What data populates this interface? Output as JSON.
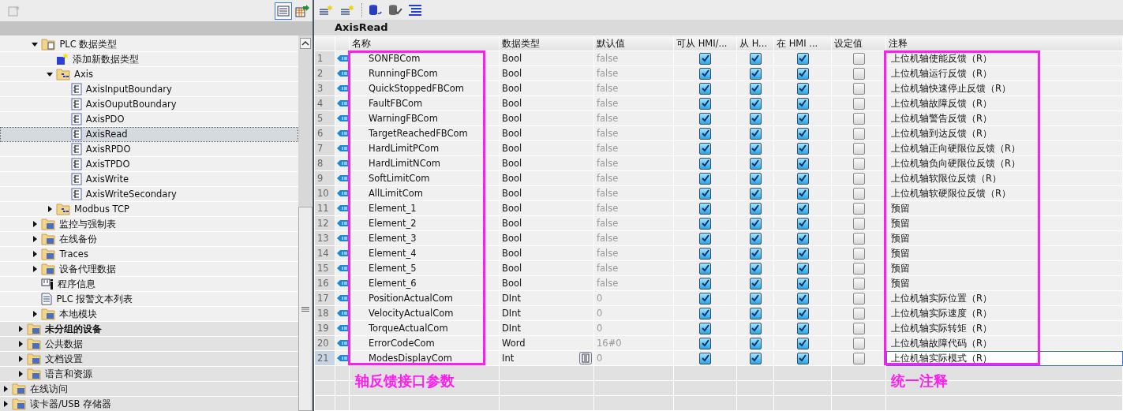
{
  "left_toolbar": {
    "view_toggle": {
      "selected": true
    }
  },
  "tree": {
    "items": [
      {
        "children": [
          {
            "children": [
              {
                "label": "PLC 数据类型",
                "kind": "typefolder",
                "expanded": true,
                "selected": false,
                "children": [
                  {
                    "label": "添加新数据类型",
                    "kind": "add",
                    "selected": false
                  },
                  {
                    "label": "Axis",
                    "kind": "structfolder",
                    "expanded": true,
                    "selected": false,
                    "children": [
                      {
                        "label": "AxisInputBoundary",
                        "kind": "type",
                        "selected": false
                      },
                      {
                        "label": "AxisOuputBoundary",
                        "kind": "type",
                        "selected": false
                      },
                      {
                        "label": "AxisPDO",
                        "kind": "type",
                        "selected": false
                      },
                      {
                        "label": "AxisRead",
                        "kind": "type",
                        "selected": true
                      },
                      {
                        "label": "AxisRPDO",
                        "kind": "type",
                        "selected": false
                      },
                      {
                        "label": "AxisTPDO",
                        "kind": "type",
                        "selected": false
                      },
                      {
                        "label": "AxisWrite",
                        "kind": "type",
                        "selected": false
                      },
                      {
                        "label": "AxisWriteSecondary",
                        "kind": "type",
                        "selected": false
                      }
                    ]
                  },
                  {
                    "label": "Modbus TCP",
                    "kind": "structfolder",
                    "expanded": false,
                    "selected": false
                  }
                ]
              },
              {
                "label": "监控与强制表",
                "kind": "folder",
                "expanded": false,
                "selected": false
              },
              {
                "label": "在线备份",
                "kind": "folder",
                "expanded": false,
                "selected": false
              },
              {
                "label": "Traces",
                "kind": "folder",
                "expanded": false,
                "selected": false
              },
              {
                "label": "设备代理数据",
                "kind": "folder",
                "expanded": false,
                "selected": false
              },
              {
                "label": "程序信息",
                "kind": "info",
                "selected": false
              },
              {
                "label": "PLC 报警文本列表",
                "kind": "textlist",
                "selected": false
              },
              {
                "label": "本地模块",
                "kind": "folder",
                "expanded": false,
                "selected": false
              }
            ]
          },
          {
            "label": "未分组的设备",
            "kind": "folder",
            "expanded": false,
            "selected": false,
            "bold": true
          },
          {
            "label": "公共数据",
            "kind": "folder",
            "expanded": false,
            "selected": false
          },
          {
            "label": "文档设置",
            "kind": "folder",
            "expanded": false,
            "selected": false
          },
          {
            "label": "语言和资源",
            "kind": "folder",
            "expanded": false,
            "selected": false
          }
        ]
      },
      {
        "label": "在线访问",
        "kind": "folder",
        "expanded": false,
        "selected": false
      },
      {
        "label": "读卡器/USB 存储器",
        "kind": "folder",
        "expanded": false,
        "selected": false
      }
    ]
  },
  "editor": {
    "title": "AxisRead",
    "columns": [
      "名称",
      "数据类型",
      "默认值",
      "可从 HMI/...",
      "从 H...",
      "在 HMI ...",
      "设定值",
      "注释"
    ],
    "rows": [
      {
        "number": "1",
        "name": "SONFBCom",
        "data_type": "Bool",
        "default_value": "false",
        "check_1": true,
        "check_2": true,
        "check_3": true,
        "setpoint": false,
        "comment": "上位机轴使能反馈（R）",
        "selected": false
      },
      {
        "number": "2",
        "name": "RunningFBCom",
        "data_type": "Bool",
        "default_value": "false",
        "check_1": true,
        "check_2": true,
        "check_3": true,
        "setpoint": false,
        "comment": "上位机轴运行反馈（R）",
        "selected": false
      },
      {
        "number": "3",
        "name": "QuickStoppedFBCom",
        "data_type": "Bool",
        "default_value": "false",
        "check_1": true,
        "check_2": true,
        "check_3": true,
        "setpoint": false,
        "comment": "上位机轴快速停止反馈（R）",
        "selected": false
      },
      {
        "number": "4",
        "name": "FaultFBCom",
        "data_type": "Bool",
        "default_value": "false",
        "check_1": true,
        "check_2": true,
        "check_3": true,
        "setpoint": false,
        "comment": "上位机轴故障反馈（R）",
        "selected": false
      },
      {
        "number": "5",
        "name": "WarningFBCom",
        "data_type": "Bool",
        "default_value": "false",
        "check_1": true,
        "check_2": true,
        "check_3": true,
        "setpoint": false,
        "comment": "上位机轴警告反馈（R）",
        "selected": false
      },
      {
        "number": "6",
        "name": "TargetReachedFBCom",
        "data_type": "Bool",
        "default_value": "false",
        "check_1": true,
        "check_2": true,
        "check_3": true,
        "setpoint": false,
        "comment": "上位机轴到达反馈（R）",
        "selected": false
      },
      {
        "number": "7",
        "name": "HardLimitPCom",
        "data_type": "Bool",
        "default_value": "false",
        "check_1": true,
        "check_2": true,
        "check_3": true,
        "setpoint": false,
        "comment": "上位机轴正向硬限位反馈（R）",
        "selected": false
      },
      {
        "number": "8",
        "name": "HardLimitNCom",
        "data_type": "Bool",
        "default_value": "false",
        "check_1": true,
        "check_2": true,
        "check_3": true,
        "setpoint": false,
        "comment": "上位机轴负向硬限位反馈（R）",
        "selected": false
      },
      {
        "number": "9",
        "name": "SoftLimitCom",
        "data_type": "Bool",
        "default_value": "false",
        "check_1": true,
        "check_2": true,
        "check_3": true,
        "setpoint": false,
        "comment": "上位机轴软限位反馈（R）",
        "selected": false
      },
      {
        "number": "10",
        "name": "AllLimitCom",
        "data_type": "Bool",
        "default_value": "false",
        "check_1": true,
        "check_2": true,
        "check_3": true,
        "setpoint": false,
        "comment": "上位机轴软硬限位反馈（R）",
        "selected": false
      },
      {
        "number": "11",
        "name": "Element_1",
        "data_type": "Bool",
        "default_value": "false",
        "check_1": true,
        "check_2": true,
        "check_3": true,
        "setpoint": false,
        "comment": "预留",
        "selected": false
      },
      {
        "number": "12",
        "name": "Element_2",
        "data_type": "Bool",
        "default_value": "false",
        "check_1": true,
        "check_2": true,
        "check_3": true,
        "setpoint": false,
        "comment": "预留",
        "selected": false
      },
      {
        "number": "13",
        "name": "Element_3",
        "data_type": "Bool",
        "default_value": "false",
        "check_1": true,
        "check_2": true,
        "check_3": true,
        "setpoint": false,
        "comment": "预留",
        "selected": false
      },
      {
        "number": "14",
        "name": "Element_4",
        "data_type": "Bool",
        "default_value": "false",
        "check_1": true,
        "check_2": true,
        "check_3": true,
        "setpoint": false,
        "comment": "预留",
        "selected": false
      },
      {
        "number": "15",
        "name": "Element_5",
        "data_type": "Bool",
        "default_value": "false",
        "check_1": true,
        "check_2": true,
        "check_3": true,
        "setpoint": false,
        "comment": "预留",
        "selected": false
      },
      {
        "number": "16",
        "name": "Element_6",
        "data_type": "Bool",
        "default_value": "false",
        "check_1": true,
        "check_2": true,
        "check_3": true,
        "setpoint": false,
        "comment": "预留",
        "selected": false
      },
      {
        "number": "17",
        "name": "PositionActualCom",
        "data_type": "DInt",
        "default_value": "0",
        "check_1": true,
        "check_2": true,
        "check_3": true,
        "setpoint": false,
        "comment": "上位机轴实际位置（R）",
        "selected": false
      },
      {
        "number": "18",
        "name": "VelocityActualCom",
        "data_type": "DInt",
        "default_value": "0",
        "check_1": true,
        "check_2": true,
        "check_3": true,
        "setpoint": false,
        "comment": "上位机轴实际速度（R）",
        "selected": false
      },
      {
        "number": "19",
        "name": "TorqueActualCom",
        "data_type": "DInt",
        "default_value": "0",
        "check_1": true,
        "check_2": true,
        "check_3": true,
        "setpoint": false,
        "comment": "上位机轴实际转矩（R）",
        "selected": false
      },
      {
        "number": "20",
        "name": "ErrorCodeCom",
        "data_type": "Word",
        "default_value": "16#0",
        "check_1": true,
        "check_2": true,
        "check_3": true,
        "setpoint": false,
        "comment": "上位机轴故障代码（R）",
        "selected": false
      },
      {
        "number": "21",
        "name": "ModesDisplayCom",
        "data_type": "Int",
        "default_value": "0",
        "check_1": true,
        "check_2": true,
        "check_3": true,
        "setpoint": false,
        "comment": "上位机轴实际模式（R）",
        "selected": true
      }
    ],
    "annotations": [
      {
        "label": "轴反馈接口参数"
      },
      {
        "label": "统一注释"
      }
    ]
  }
}
